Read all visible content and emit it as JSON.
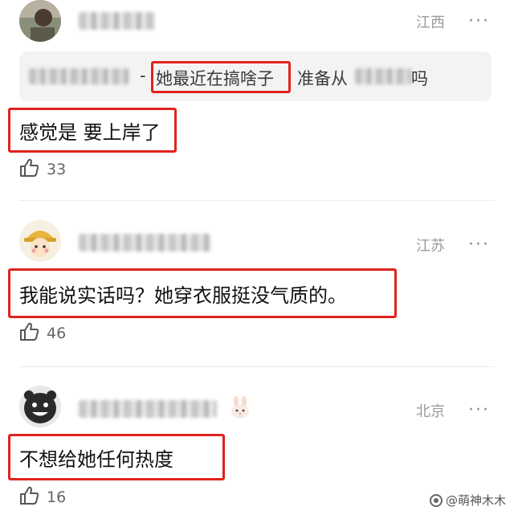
{
  "comments": [
    {
      "location": "江西",
      "more": "···",
      "reply": {
        "dash": "-",
        "highlight": "她最近在搞啥子",
        "rest_a": "准备从",
        "rest_b": "吗"
      },
      "text": "感觉是 要上岸了",
      "likes": "33"
    },
    {
      "location": "江苏",
      "more": "···",
      "text": "我能说实话吗？她穿衣服挺没气质的。",
      "likes": "46"
    },
    {
      "location": "北京",
      "more": "···",
      "text": "不想给她任何热度",
      "likes": "16"
    }
  ],
  "watermark": "@萌神木木",
  "icons": {
    "like": "thumbs-up-icon",
    "more": "more-dots-icon",
    "badge": "bunny-icon"
  },
  "colors": {
    "highlight": "#e0231e",
    "meta": "#9a9a9a",
    "reply_bg": "#f3f3f3"
  }
}
